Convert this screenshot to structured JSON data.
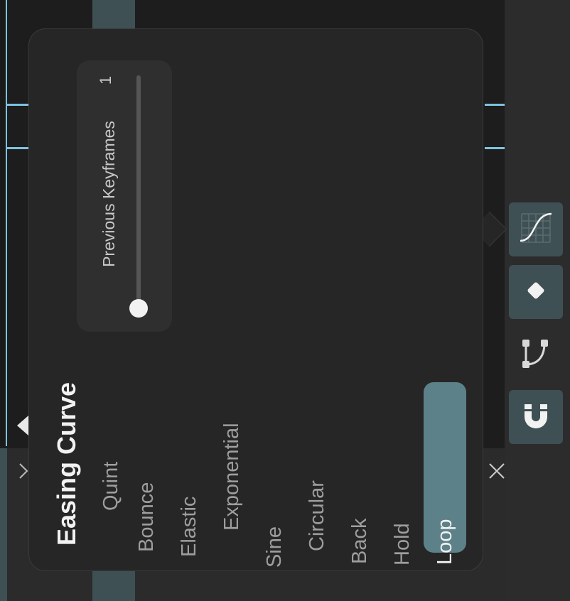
{
  "background": {
    "accent_color": "#7dc3dd",
    "column_color": "#3f5055",
    "chevron_icon": "chevron-right-icon",
    "close_icon": "close-icon"
  },
  "toolbar": {
    "items": [
      {
        "icon": "easing-curve-icon",
        "active": true
      },
      {
        "icon": "keyframe-diamond-icon",
        "active": true
      },
      {
        "icon": "bezier-path-icon",
        "active": false
      },
      {
        "icon": "magnet-icon",
        "active": true
      }
    ]
  },
  "popover": {
    "title": "Easing Curve",
    "slider": {
      "label": "Previous Keyframes",
      "value": "1",
      "fill_fraction": 0
    },
    "easing_options": [
      "Quintic",
      "Bounce",
      "Elastic",
      "Exponential",
      "Sine",
      "Circular",
      "Back",
      "Hold",
      "Loop"
    ],
    "selected": "Loop",
    "selected_color": "#5d8189"
  }
}
